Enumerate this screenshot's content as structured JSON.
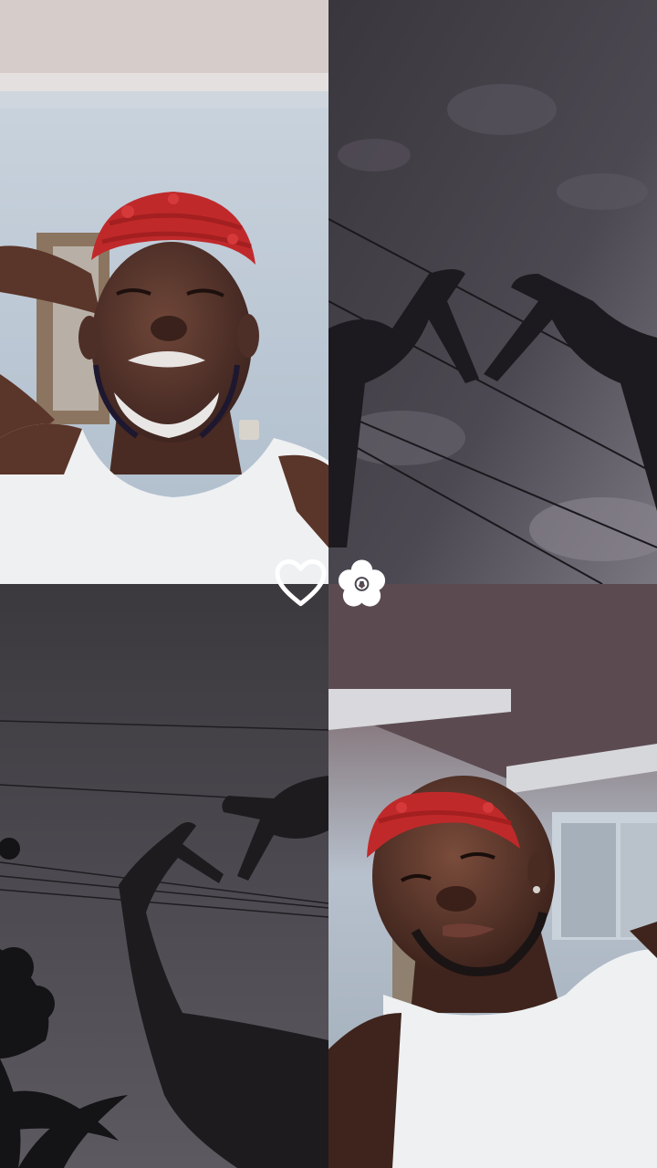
{
  "collage": {
    "layout": "2x2 photo grid",
    "tiles": [
      {
        "position": "top-left",
        "subject": "portrait-man-red-cap-white-beard"
      },
      {
        "position": "top-right",
        "subject": "hands-heart-silhouette-sky"
      },
      {
        "position": "bottom-left",
        "subject": "hands-heart-silhouette-powerlines"
      },
      {
        "position": "bottom-right",
        "subject": "portrait-man-red-cap-ceiling"
      }
    ]
  },
  "stickers": [
    {
      "icon": "heart-outline-icon",
      "color": "#ffffff"
    },
    {
      "icon": "flower-icon",
      "color": "#ffffff"
    }
  ],
  "colors": {
    "cap_red": "#c0292a",
    "tank_top": "#eef0f2",
    "sky_dark": "#514d57",
    "wall_blue": "#bcc8d6"
  }
}
